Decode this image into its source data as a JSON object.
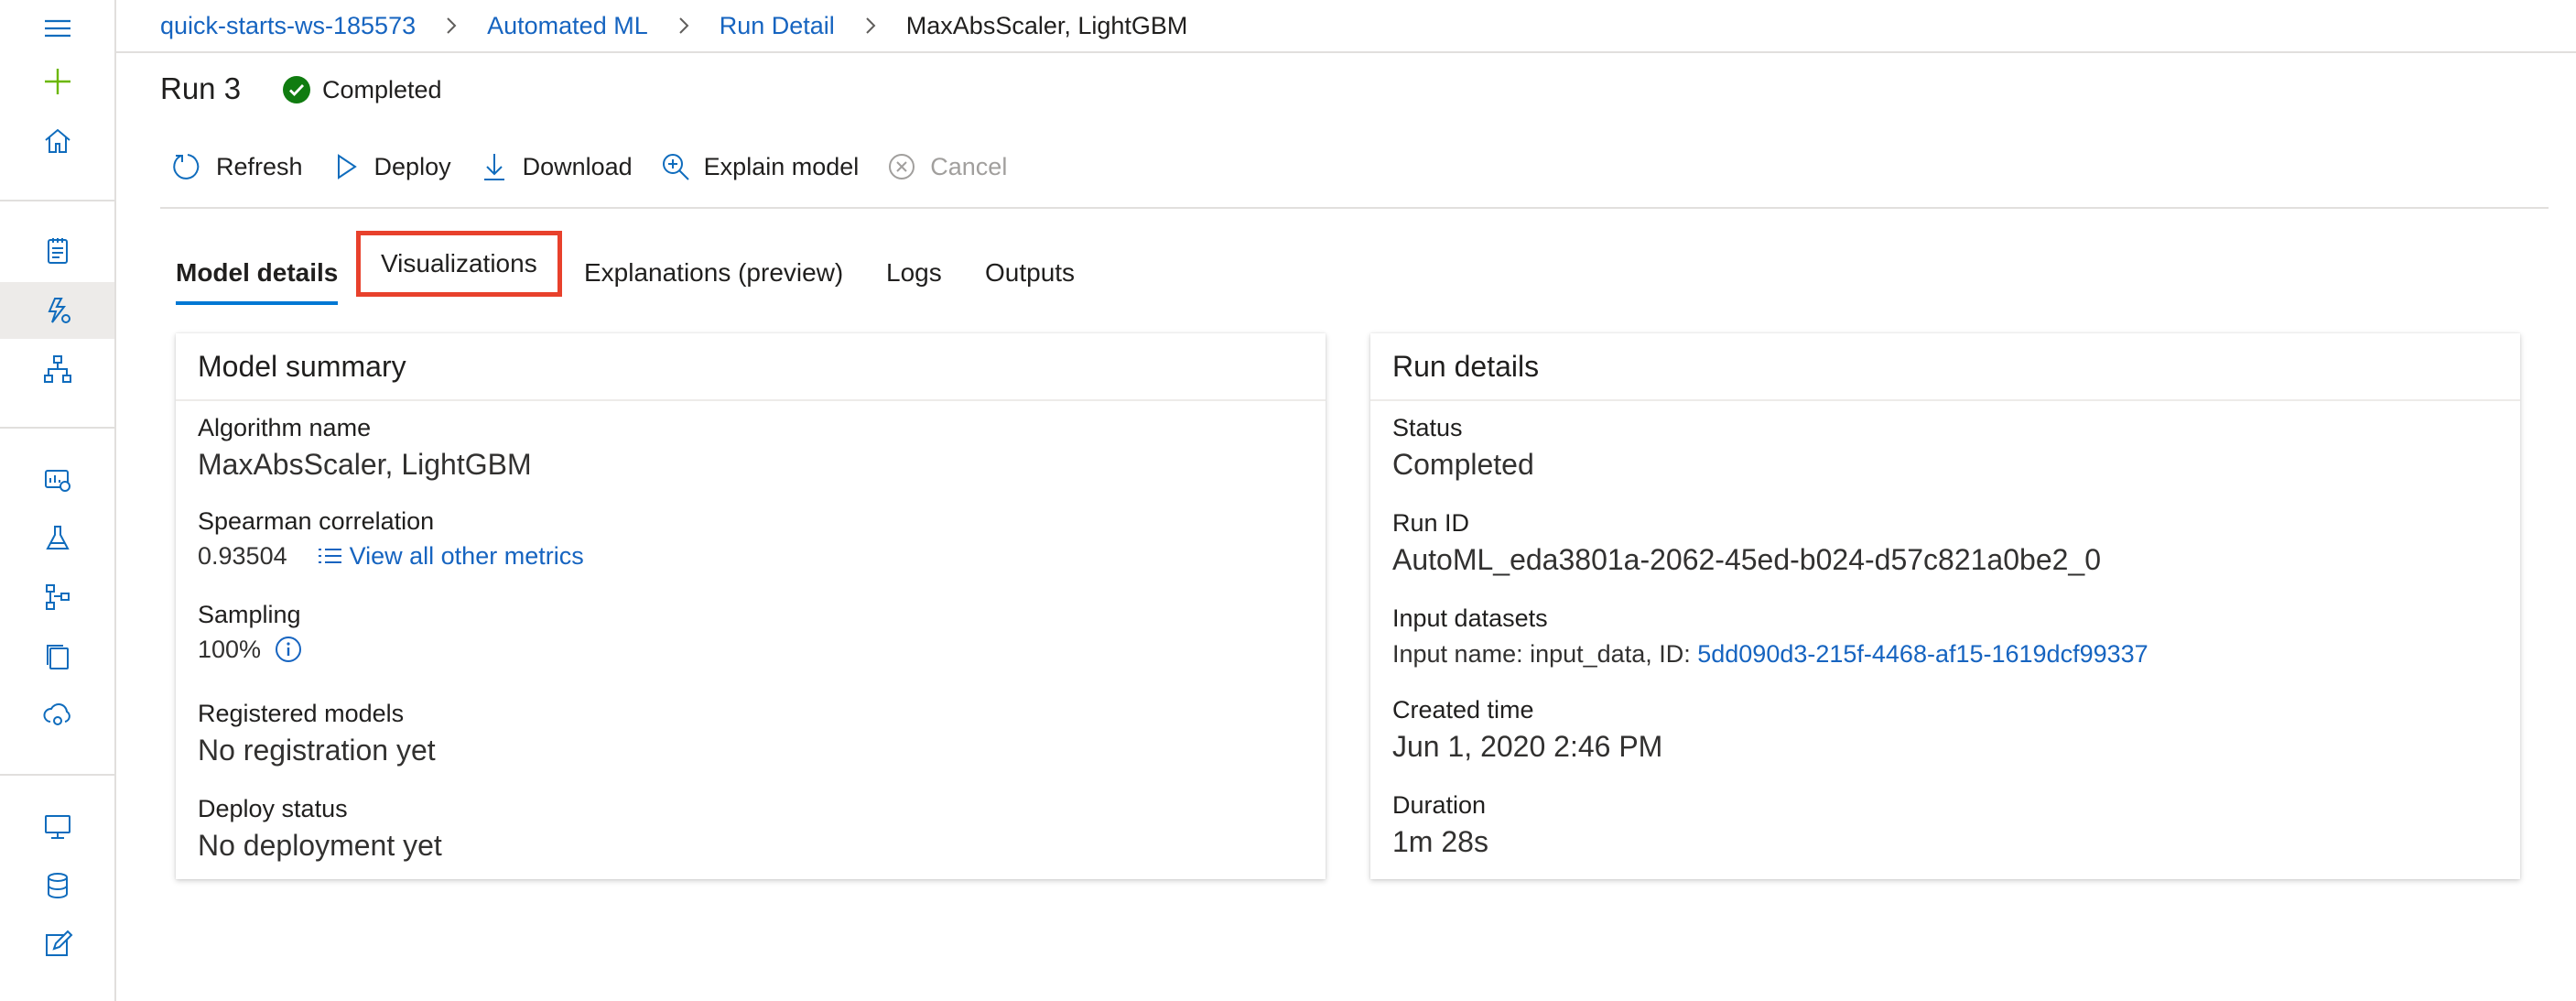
{
  "breadcrumb": {
    "workspace": "quick-starts-ws-185573",
    "automl": "Automated ML",
    "run_detail": "Run Detail",
    "current": "MaxAbsScaler, LightGBM"
  },
  "run": {
    "title": "Run 3",
    "status": "Completed"
  },
  "toolbar": {
    "refresh": "Refresh",
    "deploy": "Deploy",
    "download": "Download",
    "explain": "Explain model",
    "cancel": "Cancel"
  },
  "tabs": {
    "model_details": "Model details",
    "visualizations": "Visualizations",
    "explanations": "Explanations (preview)",
    "logs": "Logs",
    "outputs": "Outputs"
  },
  "model_summary": {
    "title": "Model summary",
    "algorithm_label": "Algorithm name",
    "algorithm_value": "MaxAbsScaler, LightGBM",
    "spearman_label": "Spearman correlation",
    "spearman_value": "0.93504",
    "metrics_link": "View all other metrics",
    "sampling_label": "Sampling",
    "sampling_value": "100%",
    "registered_label": "Registered models",
    "registered_value": "No registration yet",
    "deploy_label": "Deploy status",
    "deploy_value": "No deployment yet"
  },
  "run_details": {
    "title": "Run details",
    "status_label": "Status",
    "status_value": "Completed",
    "runid_label": "Run ID",
    "runid_value": "AutoML_eda3801a-2062-45ed-b024-d57c821a0be2_0",
    "datasets_label": "Input datasets",
    "datasets_prefix": "Input name: input_data, ID:",
    "datasets_id": "5dd090d3-215f-4468-af15-1619dcf99337",
    "created_label": "Created time",
    "created_value": "Jun 1, 2020 2:46 PM",
    "duration_label": "Duration",
    "duration_value": "1m 28s"
  },
  "colors": {
    "accent": "#0078d4",
    "link": "#1664c0",
    "success": "#107c10",
    "highlight_box": "#e8412c",
    "add_icon": "#6bb700"
  },
  "icons": {
    "rail": [
      "hamburger-icon",
      "add-icon",
      "home-icon",
      "notebook-icon",
      "automl-icon",
      "designer-icon",
      "datasets-icon",
      "experiments-icon",
      "pipelines-icon",
      "models-icon",
      "endpoints-icon",
      "compute-icon",
      "datastores-icon",
      "labeling-icon"
    ],
    "toolbar": [
      "refresh-icon",
      "deploy-icon",
      "download-icon",
      "explain-icon",
      "cancel-icon"
    ]
  }
}
